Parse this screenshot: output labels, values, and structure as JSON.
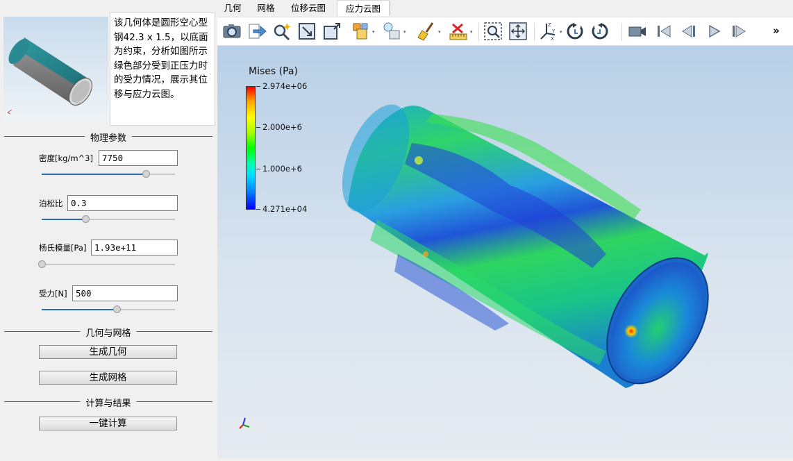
{
  "description_text": "该几何体是圆形空心型钢42.3 x 1.5，以底面为约束，分析如图所示绿色部分受到正压力时的受力情况，展示其位移与应力云图。",
  "sections": {
    "physics": "物理参数",
    "geometry_mesh": "几何与网格",
    "compute_results": "计算与结果"
  },
  "params": {
    "density": {
      "label": "密度[kg/m^3]",
      "value": "7750",
      "slider_fraction": 0.78
    },
    "poisson": {
      "label": "泊松比",
      "value": "0.3",
      "slider_fraction": 0.33
    },
    "young": {
      "label": "杨氏模量[Pa]",
      "value": "1.93e+11",
      "slider_fraction": 0.0
    },
    "force": {
      "label": "受力[N]",
      "value": "500",
      "slider_fraction": 0.56
    }
  },
  "buttons": {
    "gen_geometry": "生成几何",
    "gen_mesh": "生成网格",
    "one_click_compute": "一键计算"
  },
  "tabs": [
    "几何",
    "网格",
    "位移云图",
    "应力云图"
  ],
  "active_tab": "应力云图",
  "toolbar_icons": [
    "camera-icon",
    "export-icon",
    "magic-search-icon",
    "fit-view-icon",
    "resize-icon",
    "shapes-icon",
    "light-icon",
    "broom-icon",
    "ruler-icon",
    "zoom-box-icon",
    "pan-icon",
    "axes-icon",
    "rotate-left-icon",
    "rotate-right-icon",
    "video-icon",
    "skip-start-icon",
    "step-back-icon",
    "play-icon",
    "skip-end-icon",
    "more-icon"
  ],
  "toolbar_more": "»",
  "legend": {
    "title": "Mises (Pa)",
    "ticks": [
      "2.974e+06",
      "2.000e+6",
      "1.000e+6",
      "4.271e+04"
    ]
  },
  "colors": {
    "accent": "#2a69b5",
    "viewport_top": "#b8cfe6",
    "viewport_bottom": "#e6ebf1"
  }
}
